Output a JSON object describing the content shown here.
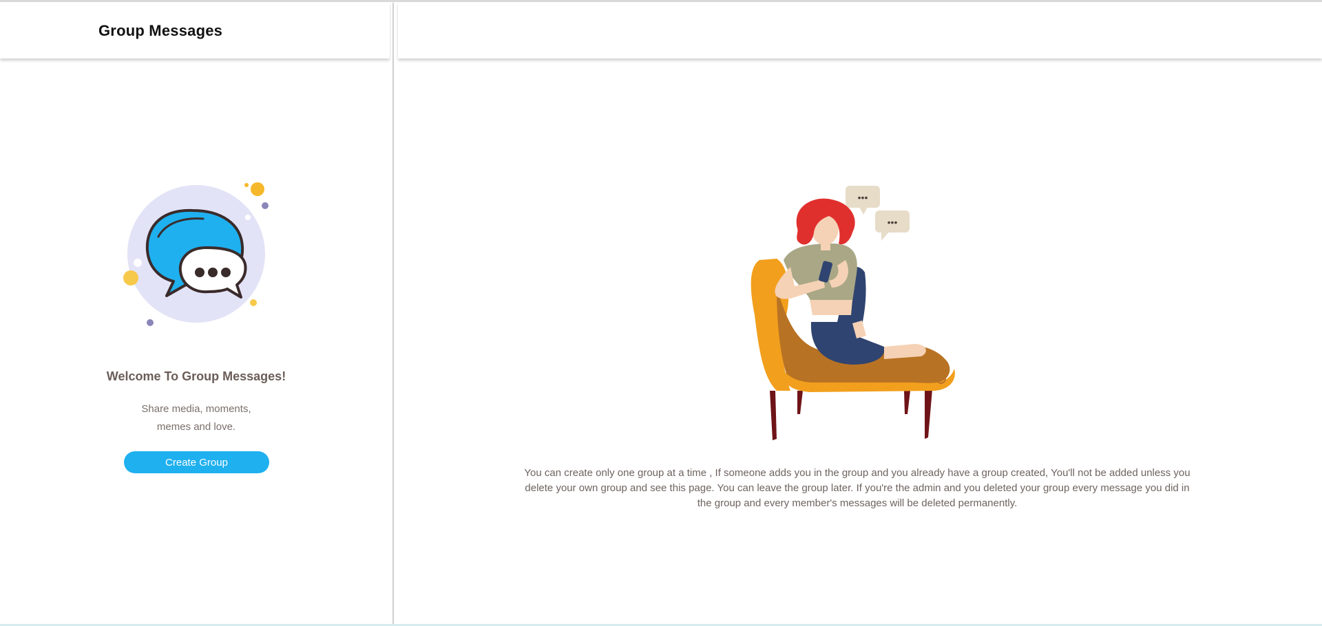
{
  "sidebar": {
    "title": "Group Messages",
    "welcome_title": "Welcome To Group Messages!",
    "welcome_line1": "Share media, moments,",
    "welcome_line2": "memes and love.",
    "create_button": "Create Group"
  },
  "main": {
    "info_text": "You can create only one group at a time , If someone adds you in the group and you already have a group created, You'll not be added unless you delete your own group and see this page. You can leave the group later. If you're the admin and you deleted your group every message you did in the group and every member's messages will be deleted permanently.",
    "bubble1_text": "•••",
    "bubble2_text": "•••"
  },
  "colors": {
    "accent": "#1fb0ef",
    "text_muted": "#7a6f6b",
    "chair": "#f29f1d",
    "bubble_bg": "#e7dcc8"
  },
  "icons": {
    "left_illustration": "chat-bubbles-illustration",
    "right_illustration": "woman-on-chaise-texting-illustration"
  }
}
